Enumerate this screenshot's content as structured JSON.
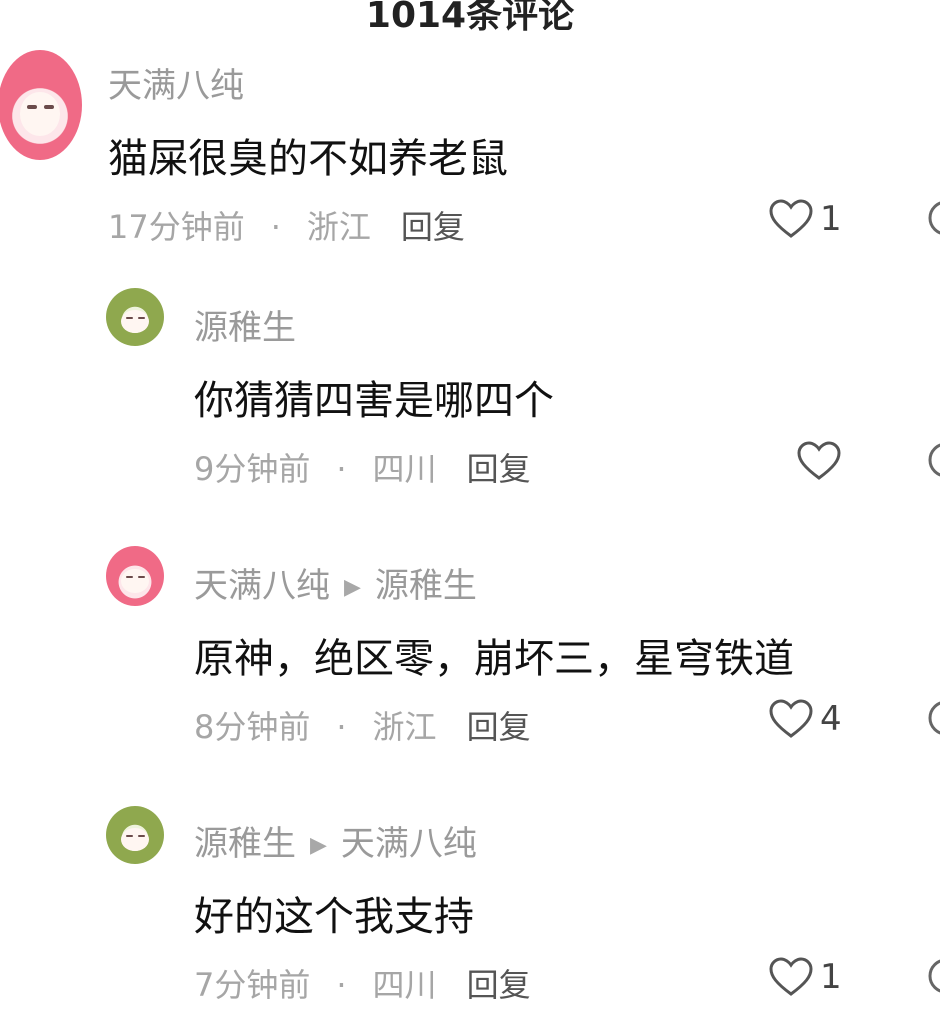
{
  "header": {
    "title": "1014条评论"
  },
  "comments": [
    {
      "username": "天满八纯",
      "reply_to": "",
      "text": "猫屎很臭的不如养老鼠",
      "time": "17分钟前",
      "location": "浙江",
      "reply_label": "回复",
      "likes": "1",
      "avatar": "pink-haired-girl-avatar"
    },
    {
      "username": "源稚生",
      "reply_to": "",
      "text": "你猜猜四害是哪四个",
      "time": "9分钟前",
      "location": "四川",
      "reply_label": "回复",
      "likes": "",
      "avatar": "green-haired-character-avatar"
    },
    {
      "username": "天满八纯",
      "reply_to": "源稚生",
      "text": "原神，绝区零，崩坏三，星穹铁道",
      "time": "8分钟前",
      "location": "浙江",
      "reply_label": "回复",
      "likes": "4",
      "avatar": "pink-haired-girl-avatar"
    },
    {
      "username": "源稚生",
      "reply_to": "天满八纯",
      "text": "好的这个我支持",
      "time": "7分钟前",
      "location": "四川",
      "reply_label": "回复",
      "likes": "1",
      "avatar": "green-haired-character-avatar"
    }
  ],
  "meta_separator": "·",
  "colors": {
    "username": "#9a9a9a",
    "meta": "#a6a6a6",
    "text": "#111111"
  }
}
